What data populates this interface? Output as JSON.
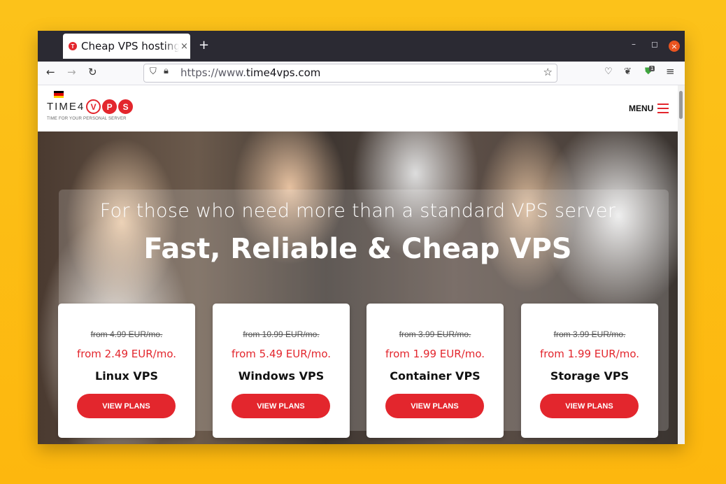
{
  "browser": {
    "tab_title": "Cheap VPS hosting",
    "tab_close": "×",
    "new_tab": "+",
    "url_prefix": "https://www.",
    "url_domain": "time4vps.com",
    "extension_badge": "1",
    "controls": {
      "minimize": "–",
      "maximize": "◻",
      "close": "×"
    }
  },
  "site": {
    "logo_text": "TIME4",
    "logo_letters": [
      "V",
      "P",
      "S"
    ],
    "tagline": "TIME FOR YOUR PERSONAL SERVER",
    "menu_label": "MENU",
    "flag_colors": [
      "#000000",
      "#dd0000",
      "#ffce00"
    ]
  },
  "hero": {
    "subtitle": "For those who need more than a standard VPS server",
    "title": "Fast, Reliable & Cheap VPS"
  },
  "cards": [
    {
      "old_price": "from 4.99 EUR/mo.",
      "new_price": "from 2.49 EUR/mo.",
      "name": "Linux VPS",
      "button": "VIEW PLANS"
    },
    {
      "old_price": "from 10.99 EUR/mo.",
      "new_price": "from 5.49 EUR/mo.",
      "name": "Windows VPS",
      "button": "VIEW PLANS"
    },
    {
      "old_price": "from 3.99 EUR/mo.",
      "new_price": "from 1.99 EUR/mo.",
      "name": "Container VPS",
      "button": "VIEW PLANS"
    },
    {
      "old_price": "from 3.99 EUR/mo.",
      "new_price": "from 1.99 EUR/mo.",
      "name": "Storage VPS",
      "button": "VIEW PLANS"
    }
  ],
  "colors": {
    "accent": "#e3262d",
    "desktop_bg": "#fcc21a"
  }
}
